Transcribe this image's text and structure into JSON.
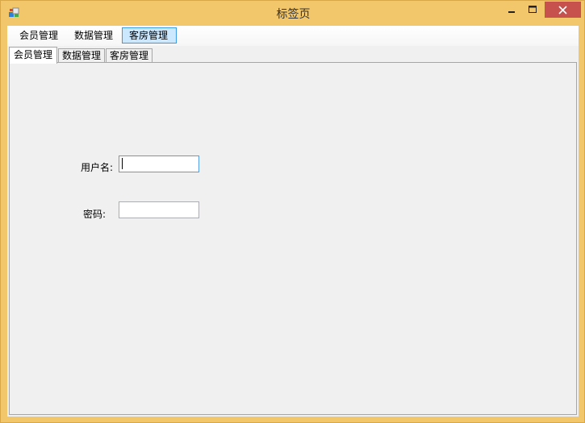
{
  "window": {
    "title": "标签页",
    "controls": {
      "minimize_icon": "minimize-icon",
      "maximize_icon": "maximize-icon",
      "close_icon": "close-icon"
    }
  },
  "menu": {
    "items": [
      {
        "label": "会员管理"
      },
      {
        "label": "数据管理"
      },
      {
        "label": "客房管理",
        "active": true
      }
    ]
  },
  "tabs": [
    {
      "label": "会员管理",
      "selected": true
    },
    {
      "label": "数据管理"
    },
    {
      "label": "客房管理"
    }
  ],
  "form": {
    "username_label": "用户名:",
    "username_value": "",
    "password_label": "密码:",
    "password_value": ""
  },
  "colors": {
    "frame": "#f2c66b",
    "close_button": "#c7514c",
    "menu_active_bg": "#cce8ff",
    "menu_active_border": "#3e99e6"
  }
}
